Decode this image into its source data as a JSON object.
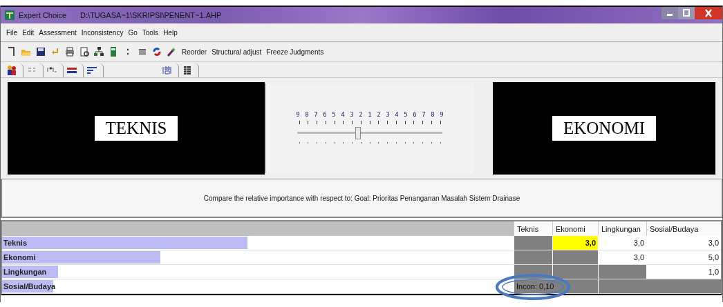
{
  "window": {
    "app": "Expert Choice",
    "file": "D:\\TUGASA~1\\SKRIPSI\\PENENT~1.AHP"
  },
  "menu": [
    "File",
    "Edit",
    "Assessment",
    "Inconsistency",
    "Go",
    "Tools",
    "Help"
  ],
  "toolbar": {
    "text_buttons": [
      "Reorder",
      "Structural adjust",
      "Freeze Judgments"
    ]
  },
  "compare": {
    "left": "TEKNIS",
    "right": "EKONOMI",
    "scale": [
      "9",
      "8",
      "7",
      "6",
      "5",
      "4",
      "3",
      "2",
      "1",
      "2",
      "3",
      "4",
      "5",
      "6",
      "7",
      "8",
      "9"
    ],
    "slider": {
      "level": 0.42
    }
  },
  "question": "Compare the relative importance  with respect to: Goal: Prioritas Penanganan Masalah Sistem Drainase",
  "matrix": {
    "columns": [
      "Teknis",
      "Ekonomi",
      "Lingkungan",
      "Sosial/Budaya"
    ],
    "rows": [
      {
        "label": "Teknis",
        "level": 0.48,
        "cells": [
          {
            "kind": "blank"
          },
          {
            "kind": "value",
            "text": "3,0",
            "selected": true
          },
          {
            "kind": "value",
            "text": "3,0",
            "selected": false
          },
          {
            "kind": "value",
            "text": "3,0",
            "selected": false
          }
        ]
      },
      {
        "label": "Ekonomi",
        "level": 0.31,
        "cells": [
          {
            "kind": "blank"
          },
          {
            "kind": "blank"
          },
          {
            "kind": "value",
            "text": "3,0",
            "selected": false
          },
          {
            "kind": "value",
            "text": "5,0",
            "selected": false
          }
        ]
      },
      {
        "label": "Lingkungan",
        "level": 0.11,
        "cells": [
          {
            "kind": "blank"
          },
          {
            "kind": "blank"
          },
          {
            "kind": "blank"
          },
          {
            "kind": "value",
            "text": "1,0",
            "selected": false
          }
        ]
      },
      {
        "label": "Sosial/Budaya",
        "level": 0.1,
        "cells": [
          {
            "kind": "incon",
            "text": "Incon: 0,10"
          },
          {
            "kind": "blank"
          }
        ]
      }
    ]
  }
}
